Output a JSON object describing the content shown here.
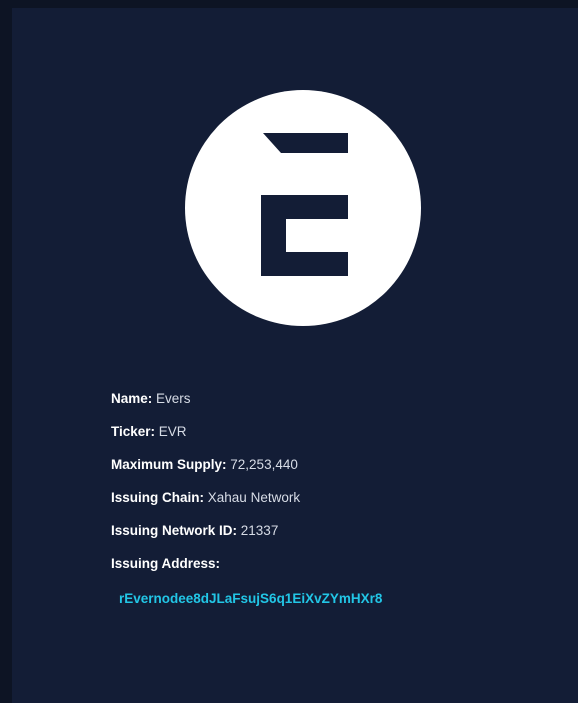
{
  "token": {
    "logo_icon": "evernode-e-logo",
    "fields": [
      {
        "label": "Name:",
        "value": "Evers"
      },
      {
        "label": "Ticker:",
        "value": "EVR"
      },
      {
        "label": "Maximum Supply:",
        "value": "72,253,440"
      },
      {
        "label": "Issuing Chain:",
        "value": "Xahau Network"
      },
      {
        "label": "Issuing Network ID:",
        "value": "21337"
      },
      {
        "label": "Issuing Address:",
        "value": ""
      }
    ],
    "address": "rEvernodee8dJLaFsujS6q1EiXvZYmHXr8"
  },
  "colors": {
    "page_background": "#0d1424",
    "panel_background": "#131d36",
    "logo_circle": "#ffffff",
    "logo_mark": "#131d36",
    "address_accent": "#22c6e6"
  }
}
